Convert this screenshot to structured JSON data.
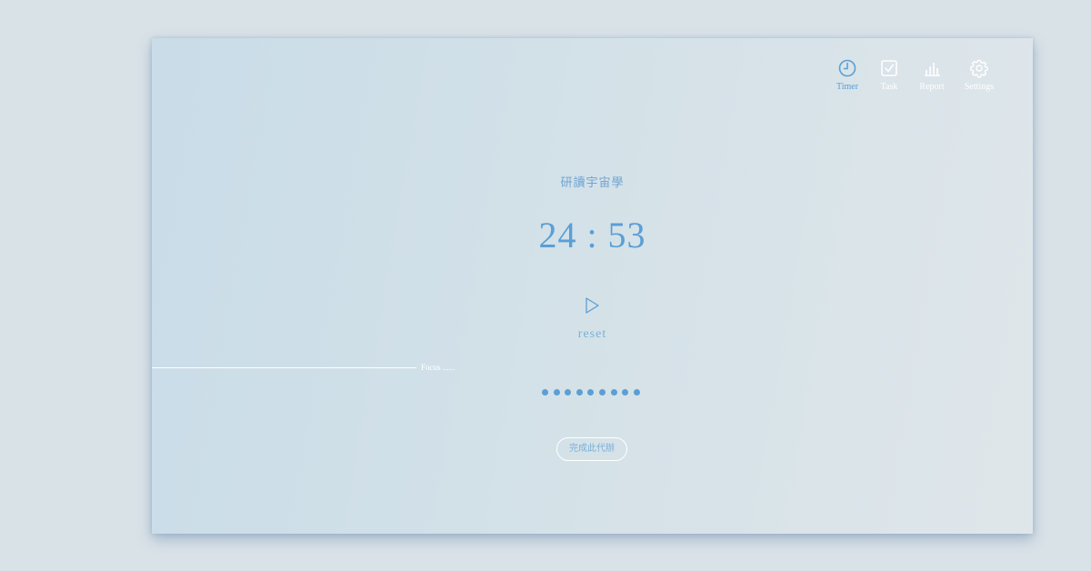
{
  "nav": {
    "items": [
      {
        "label": "Timer",
        "icon": "clock-icon",
        "active": true
      },
      {
        "label": "Task",
        "icon": "checkbox-icon",
        "active": false
      },
      {
        "label": "Report",
        "icon": "bar-chart-icon",
        "active": false
      },
      {
        "label": "Settings",
        "icon": "gear-icon",
        "active": false
      }
    ]
  },
  "task": {
    "title": "研讀宇宙學"
  },
  "timer": {
    "display": "24 : 53"
  },
  "controls": {
    "play_icon": "play-icon",
    "reset_label": "reset",
    "finish_label": "完成此代辦"
  },
  "focus": {
    "label": "Focus ......"
  },
  "pomodoros": {
    "count": 9
  },
  "colors": {
    "accent": "#5b9fd4",
    "page_background": "#d9e2e7",
    "inactive_nav": "#ffffff"
  }
}
